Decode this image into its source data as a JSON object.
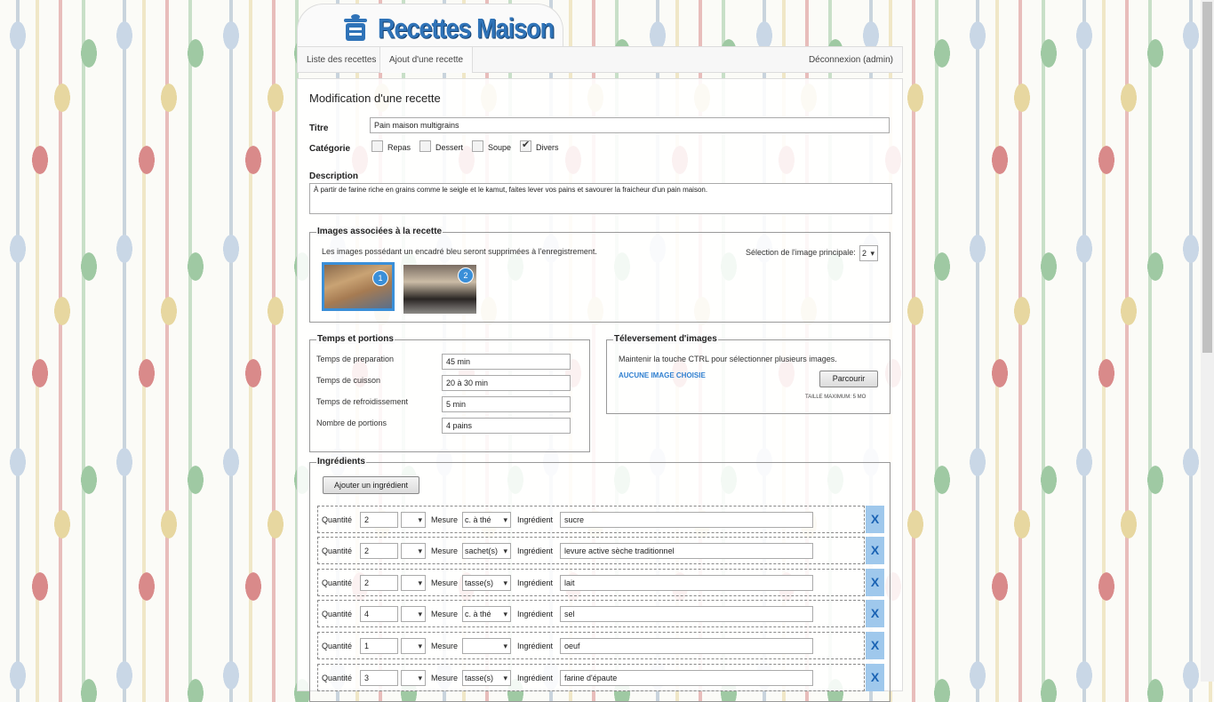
{
  "logo": {
    "text": "Recettes Maison"
  },
  "nav": {
    "list": "Liste des recettes",
    "add": "Ajout d'une recette",
    "logout": "Déconnexion (admin)"
  },
  "form": {
    "heading": "Modification d'une recette",
    "title_label": "Titre",
    "title_value": "Pain maison multigrains",
    "category_label": "Catégorie",
    "categories": [
      {
        "label": "Repas",
        "checked": false
      },
      {
        "label": "Dessert",
        "checked": false
      },
      {
        "label": "Soupe",
        "checked": false
      },
      {
        "label": "Divers",
        "checked": true
      }
    ],
    "description_label": "Description",
    "description_value": "À partir de farine riche en grains comme le seigle et le kamut, faites lever vos pains et savourer la fraicheur d'un pain maison."
  },
  "images": {
    "legend": "Images associées à la recette",
    "note": "Les images possédant un encadré bleu seront supprimées à l'enregistrement.",
    "main_label": "Sélection de l'image principale:",
    "main_value": "2",
    "thumbs": [
      {
        "badge": "1"
      },
      {
        "badge": "2"
      }
    ]
  },
  "times": {
    "legend": "Temps et portions",
    "prep_label": "Temps de preparation",
    "prep_value": "45 min",
    "cook_label": "Temps de cuisson",
    "cook_value": "20 à 30 min",
    "cool_label": "Temps de refroidissement",
    "cool_value": "5 min",
    "portions_label": "Nombre de portions",
    "portions_value": "4 pains"
  },
  "upload": {
    "legend": "Téleversement d'images",
    "hint": "Maintenir la touche CTRL pour sélectionner plusieurs images.",
    "none": "AUCUNE IMAGE CHOISIE",
    "browse": "Parcourir",
    "max": "TAILLE MAXIMUM: 5 MO"
  },
  "ingredients": {
    "legend": "Ingrédients",
    "add_button": "Ajouter un ingrédient",
    "qty_label": "Quantité",
    "measure_label": "Mesure",
    "ingredient_label": "Ingrédient",
    "delete_glyph": "X",
    "rows": [
      {
        "qty": "2",
        "measure": "c. à thé",
        "name": "sucre"
      },
      {
        "qty": "2",
        "measure": "sachet(s)",
        "name": "levure active sèche traditionnel"
      },
      {
        "qty": "2",
        "measure": "tasse(s)",
        "name": "lait"
      },
      {
        "qty": "4",
        "measure": "c. à thé",
        "name": "sel"
      },
      {
        "qty": "1",
        "measure": "",
        "name": "oeuf"
      },
      {
        "qty": "3",
        "measure": "tasse(s)",
        "name": "farine d'épaute"
      }
    ]
  }
}
